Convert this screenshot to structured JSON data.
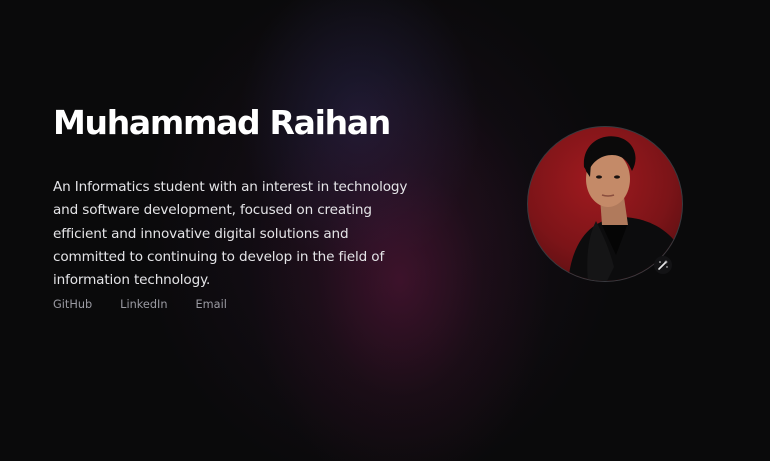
{
  "hero": {
    "name": "Muhammad Raihan",
    "description": "An Informatics student with an interest in technology and software development, focused on creating efficient and innovative digital solutions and committed to continuing to develop in the field of information technology."
  },
  "social": {
    "links": [
      {
        "label": "GitHub",
        "icon": "github-link"
      },
      {
        "label": "LinkedIn",
        "icon": "linkedin-link"
      },
      {
        "label": "Email",
        "icon": "email-link"
      }
    ]
  },
  "avatar": {
    "icon": "profile-photo",
    "background_color": "#8a1519"
  },
  "badge": {
    "icon": "magic-wand-icon"
  },
  "colors": {
    "background": "#0a0a0b",
    "title": "#ffffff",
    "text": "#e4e4e7",
    "link": "#9a9aa2"
  }
}
